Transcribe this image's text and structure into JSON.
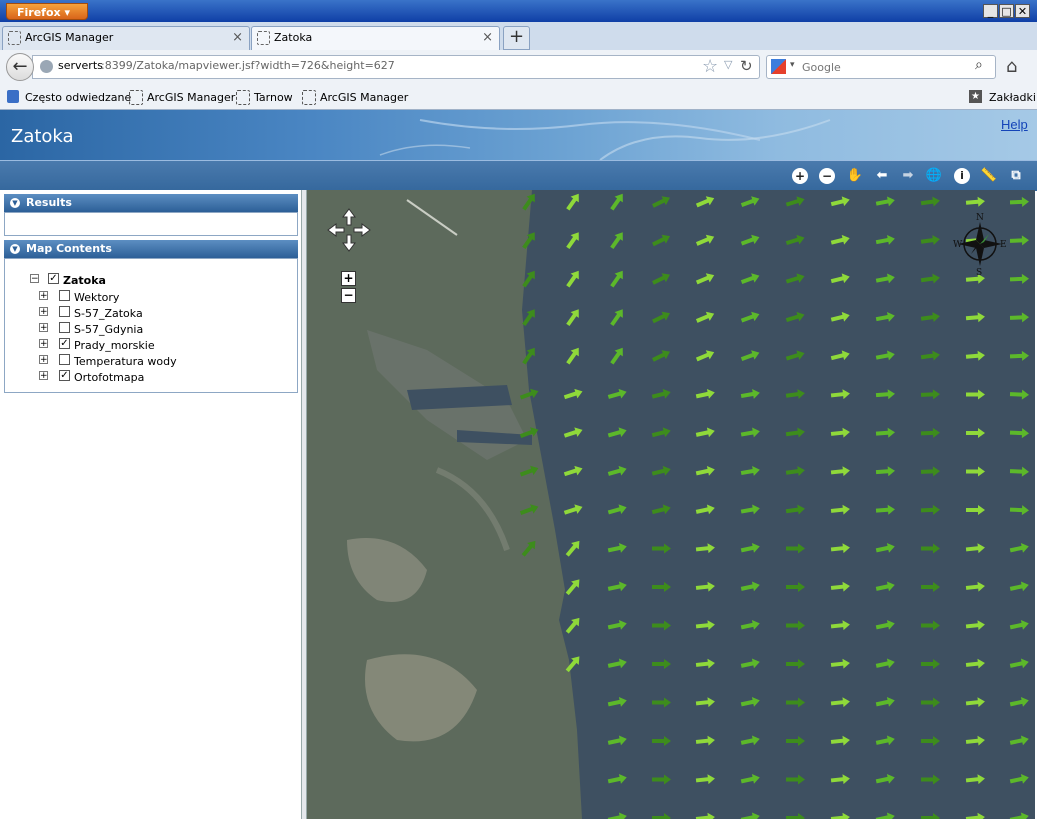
{
  "browser": {
    "app_button": "Firefox",
    "window_controls": {
      "minimize": "_",
      "maximize": "□",
      "close": "✕"
    },
    "tabs": [
      {
        "label": "ArcGIS Manager",
        "active": false,
        "close": "×"
      },
      {
        "label": "Zatoka",
        "active": true,
        "close": "×"
      }
    ],
    "new_tab": "+",
    "url": {
      "host": "serverts",
      "rest": ":8399/Zatoka/mapviewer.jsf?width=726&height=627"
    },
    "search_placeholder": "Google",
    "bookmarks": [
      "Często odwiedzane",
      "ArcGIS Manager",
      "Tarnow",
      "ArcGIS Manager"
    ],
    "bookmarks_menu": "Zakładki"
  },
  "app": {
    "title": "Zatoka",
    "help_label": "Help",
    "toolbar": [
      "zoom-in-icon",
      "zoom-out-icon",
      "pan-hand-icon",
      "back-arrow-icon",
      "forward-arrow-icon",
      "full-extent-globe-icon",
      "identify-info-icon",
      "measure-icon",
      "overview-map-icon"
    ]
  },
  "panels": {
    "results": {
      "title": "Results"
    },
    "map_contents": {
      "title": "Map Contents",
      "root": {
        "label": "Zatoka",
        "checked": true
      },
      "layers": [
        {
          "label": "Wektory",
          "checked": false
        },
        {
          "label": "S-57_Zatoka",
          "checked": false
        },
        {
          "label": "S-57_Gdynia",
          "checked": false
        },
        {
          "label": "Prady_morskie",
          "checked": true
        },
        {
          "label": "Temperatura wody",
          "checked": false
        },
        {
          "label": "Ortofotmapa",
          "checked": true
        }
      ]
    }
  },
  "map": {
    "zoom_in": "+",
    "zoom_out": "−",
    "compass": {
      "n": "N",
      "s": "S",
      "e": "E",
      "w": "W"
    },
    "sea_color": "#3e5061",
    "land_color": "#5d6a5c",
    "arrow_colors": [
      "#3d8c1c",
      "#5cb82a",
      "#8fd93a"
    ]
  }
}
